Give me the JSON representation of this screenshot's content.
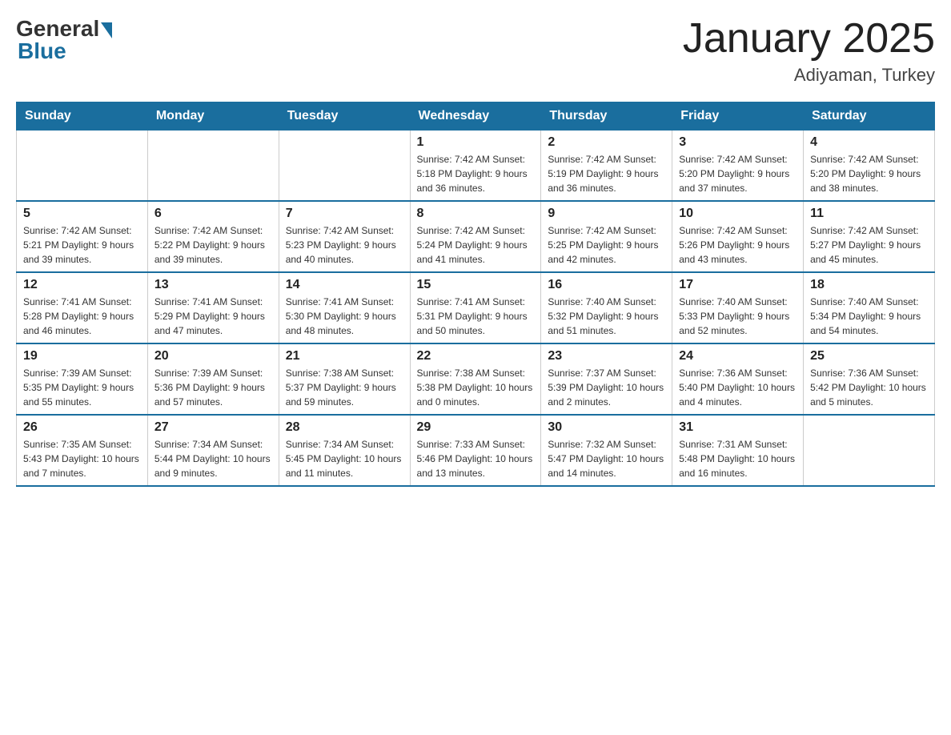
{
  "logo": {
    "general": "General",
    "blue": "Blue"
  },
  "title": "January 2025",
  "location": "Adiyaman, Turkey",
  "weekdays": [
    "Sunday",
    "Monday",
    "Tuesday",
    "Wednesday",
    "Thursday",
    "Friday",
    "Saturday"
  ],
  "weeks": [
    [
      {
        "day": "",
        "info": ""
      },
      {
        "day": "",
        "info": ""
      },
      {
        "day": "",
        "info": ""
      },
      {
        "day": "1",
        "info": "Sunrise: 7:42 AM\nSunset: 5:18 PM\nDaylight: 9 hours and 36 minutes."
      },
      {
        "day": "2",
        "info": "Sunrise: 7:42 AM\nSunset: 5:19 PM\nDaylight: 9 hours and 36 minutes."
      },
      {
        "day": "3",
        "info": "Sunrise: 7:42 AM\nSunset: 5:20 PM\nDaylight: 9 hours and 37 minutes."
      },
      {
        "day": "4",
        "info": "Sunrise: 7:42 AM\nSunset: 5:20 PM\nDaylight: 9 hours and 38 minutes."
      }
    ],
    [
      {
        "day": "5",
        "info": "Sunrise: 7:42 AM\nSunset: 5:21 PM\nDaylight: 9 hours and 39 minutes."
      },
      {
        "day": "6",
        "info": "Sunrise: 7:42 AM\nSunset: 5:22 PM\nDaylight: 9 hours and 39 minutes."
      },
      {
        "day": "7",
        "info": "Sunrise: 7:42 AM\nSunset: 5:23 PM\nDaylight: 9 hours and 40 minutes."
      },
      {
        "day": "8",
        "info": "Sunrise: 7:42 AM\nSunset: 5:24 PM\nDaylight: 9 hours and 41 minutes."
      },
      {
        "day": "9",
        "info": "Sunrise: 7:42 AM\nSunset: 5:25 PM\nDaylight: 9 hours and 42 minutes."
      },
      {
        "day": "10",
        "info": "Sunrise: 7:42 AM\nSunset: 5:26 PM\nDaylight: 9 hours and 43 minutes."
      },
      {
        "day": "11",
        "info": "Sunrise: 7:42 AM\nSunset: 5:27 PM\nDaylight: 9 hours and 45 minutes."
      }
    ],
    [
      {
        "day": "12",
        "info": "Sunrise: 7:41 AM\nSunset: 5:28 PM\nDaylight: 9 hours and 46 minutes."
      },
      {
        "day": "13",
        "info": "Sunrise: 7:41 AM\nSunset: 5:29 PM\nDaylight: 9 hours and 47 minutes."
      },
      {
        "day": "14",
        "info": "Sunrise: 7:41 AM\nSunset: 5:30 PM\nDaylight: 9 hours and 48 minutes."
      },
      {
        "day": "15",
        "info": "Sunrise: 7:41 AM\nSunset: 5:31 PM\nDaylight: 9 hours and 50 minutes."
      },
      {
        "day": "16",
        "info": "Sunrise: 7:40 AM\nSunset: 5:32 PM\nDaylight: 9 hours and 51 minutes."
      },
      {
        "day": "17",
        "info": "Sunrise: 7:40 AM\nSunset: 5:33 PM\nDaylight: 9 hours and 52 minutes."
      },
      {
        "day": "18",
        "info": "Sunrise: 7:40 AM\nSunset: 5:34 PM\nDaylight: 9 hours and 54 minutes."
      }
    ],
    [
      {
        "day": "19",
        "info": "Sunrise: 7:39 AM\nSunset: 5:35 PM\nDaylight: 9 hours and 55 minutes."
      },
      {
        "day": "20",
        "info": "Sunrise: 7:39 AM\nSunset: 5:36 PM\nDaylight: 9 hours and 57 minutes."
      },
      {
        "day": "21",
        "info": "Sunrise: 7:38 AM\nSunset: 5:37 PM\nDaylight: 9 hours and 59 minutes."
      },
      {
        "day": "22",
        "info": "Sunrise: 7:38 AM\nSunset: 5:38 PM\nDaylight: 10 hours and 0 minutes."
      },
      {
        "day": "23",
        "info": "Sunrise: 7:37 AM\nSunset: 5:39 PM\nDaylight: 10 hours and 2 minutes."
      },
      {
        "day": "24",
        "info": "Sunrise: 7:36 AM\nSunset: 5:40 PM\nDaylight: 10 hours and 4 minutes."
      },
      {
        "day": "25",
        "info": "Sunrise: 7:36 AM\nSunset: 5:42 PM\nDaylight: 10 hours and 5 minutes."
      }
    ],
    [
      {
        "day": "26",
        "info": "Sunrise: 7:35 AM\nSunset: 5:43 PM\nDaylight: 10 hours and 7 minutes."
      },
      {
        "day": "27",
        "info": "Sunrise: 7:34 AM\nSunset: 5:44 PM\nDaylight: 10 hours and 9 minutes."
      },
      {
        "day": "28",
        "info": "Sunrise: 7:34 AM\nSunset: 5:45 PM\nDaylight: 10 hours and 11 minutes."
      },
      {
        "day": "29",
        "info": "Sunrise: 7:33 AM\nSunset: 5:46 PM\nDaylight: 10 hours and 13 minutes."
      },
      {
        "day": "30",
        "info": "Sunrise: 7:32 AM\nSunset: 5:47 PM\nDaylight: 10 hours and 14 minutes."
      },
      {
        "day": "31",
        "info": "Sunrise: 7:31 AM\nSunset: 5:48 PM\nDaylight: 10 hours and 16 minutes."
      },
      {
        "day": "",
        "info": ""
      }
    ]
  ]
}
